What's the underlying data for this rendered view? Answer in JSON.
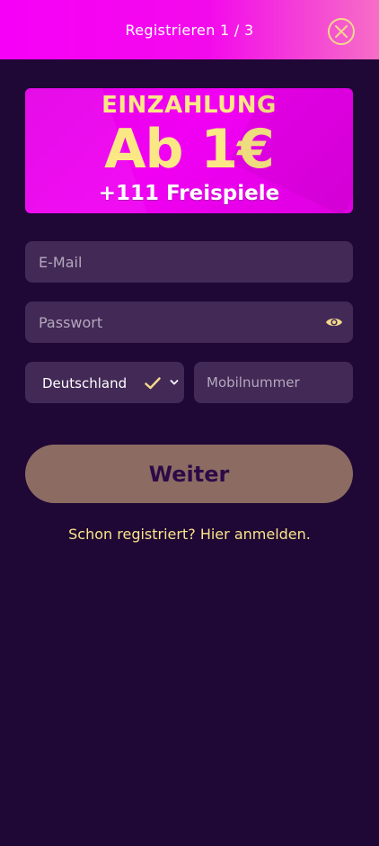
{
  "header": {
    "title": "Registrieren 1 / 3",
    "close_icon": "close-circle-icon"
  },
  "banner": {
    "line1": "EINZAHLUNG",
    "line2": "Ab 1€",
    "line3": "+111 Freispiele"
  },
  "form": {
    "email_placeholder": "E-Mail",
    "password_placeholder": "Passwort",
    "password_icon": "eye-icon",
    "country_selected": "Deutschland",
    "country_check_icon": "check-icon",
    "country_dropdown_icon": "chevron-down-icon",
    "phone_placeholder": "Mobilnummer",
    "submit_label": "Weiter"
  },
  "footer": {
    "login_link": "Schon registriert? Hier anmelden."
  },
  "colors": {
    "background": "#1f0736",
    "field": "#422956",
    "accent": "#fbe48a",
    "button": "#8c6c62",
    "header_pink": "#f700f7"
  }
}
